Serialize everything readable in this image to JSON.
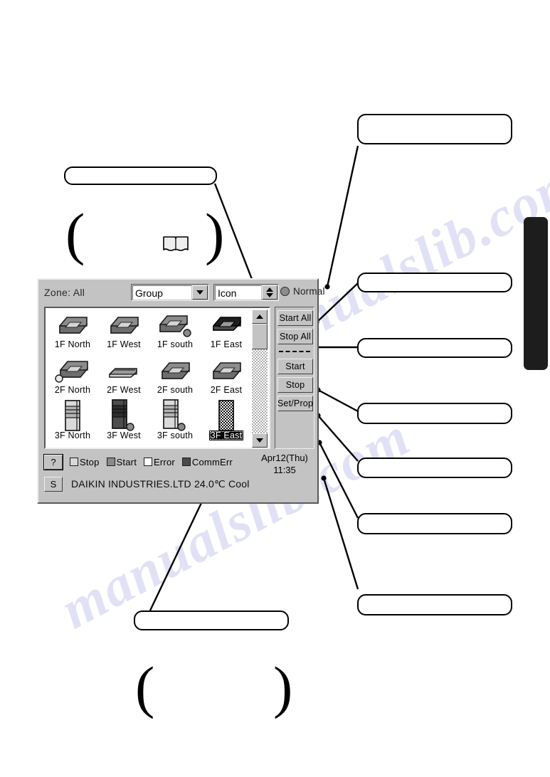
{
  "page": {
    "watermark_text": "manualslib.com",
    "page_tab": "black-edge-tab"
  },
  "callouts": [
    {
      "id": "callout-top-left",
      "text": ""
    },
    {
      "id": "callout-top-right",
      "text": ""
    },
    {
      "id": "callout-right-1",
      "text": ""
    },
    {
      "id": "callout-right-2",
      "text": ""
    },
    {
      "id": "callout-right-3",
      "text": ""
    },
    {
      "id": "callout-right-4",
      "text": ""
    },
    {
      "id": "callout-right-5",
      "text": ""
    },
    {
      "id": "callout-right-6",
      "text": ""
    },
    {
      "id": "callout-bottom",
      "text": ""
    }
  ],
  "app": {
    "zone_label": "Zone: All",
    "group_select": {
      "value": "Group",
      "options": [
        "Group"
      ]
    },
    "view_select": {
      "value": "Icon",
      "options": [
        "Icon"
      ]
    },
    "status_indicator": {
      "label": "Normal",
      "color": "#8d8d8d"
    },
    "units": [
      {
        "name": "1F North",
        "type": "cassette",
        "state": "stop",
        "badge": false
      },
      {
        "name": "1F West",
        "type": "cassette",
        "state": "stop",
        "badge": false
      },
      {
        "name": "1F south",
        "type": "cassette",
        "state": "stop",
        "badge": true
      },
      {
        "name": "1F East",
        "type": "cassette-dark",
        "state": "commerr",
        "badge": false
      },
      {
        "name": "2F North",
        "type": "cassette",
        "state": "stop",
        "badge": true
      },
      {
        "name": "2F West",
        "type": "ducted",
        "state": "stop",
        "badge": false
      },
      {
        "name": "2F south",
        "type": "cassette",
        "state": "stop",
        "badge": false
      },
      {
        "name": "2F East",
        "type": "cassette",
        "state": "stop",
        "badge": false
      },
      {
        "name": "3F North",
        "type": "floor",
        "state": "stop",
        "badge": false
      },
      {
        "name": "3F West",
        "type": "floor-dark",
        "state": "start",
        "badge": true
      },
      {
        "name": "3F south",
        "type": "floor",
        "state": "stop",
        "badge": true
      },
      {
        "name": "3F East",
        "type": "floor-hatch",
        "state": "error",
        "badge": false,
        "selected": true
      }
    ],
    "buttons": {
      "start_all": "Start All",
      "stop_all": "Stop All",
      "start": "Start",
      "stop": "Stop",
      "set_prop": "Set/Prop"
    },
    "help_button": "?",
    "s_button": "S",
    "legend": [
      {
        "label": "Stop",
        "color": "#d8d8d8"
      },
      {
        "label": "Start",
        "color": "#8a8a8a"
      },
      {
        "label": "Error",
        "color": "#ffffff"
      },
      {
        "label": "CommErr",
        "color": "#4a4a4a"
      }
    ],
    "clock": {
      "date": "Apr12(Thu)",
      "time": "11:35"
    },
    "status_text": "DAIKIN INDUSTRIES.LTD 24.0℃ Cool",
    "scrollbar": {
      "up_arrow": "scroll-up-icon",
      "down_arrow": "scroll-down-icon"
    }
  }
}
